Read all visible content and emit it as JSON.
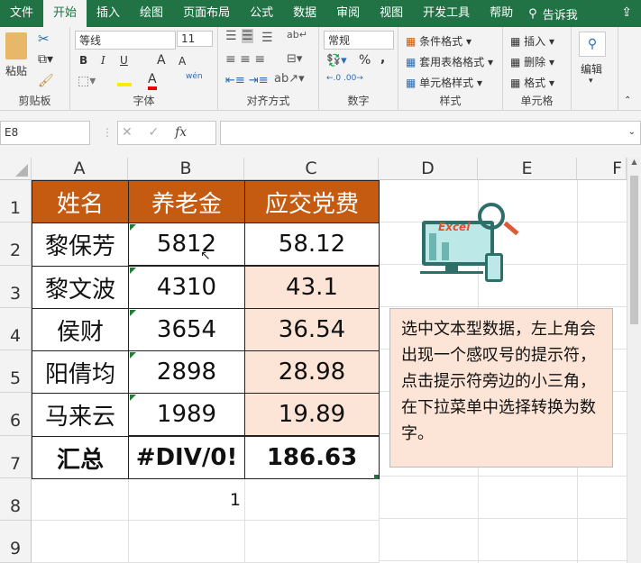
{
  "tabs": [
    "文件",
    "开始",
    "插入",
    "绘图",
    "页面布局",
    "公式",
    "数据",
    "审阅",
    "视图",
    "开发工具",
    "帮助"
  ],
  "tell_me": "告诉我",
  "ribbon": {
    "clipboard": {
      "label": "剪贴板",
      "paste": "粘贴"
    },
    "font": {
      "label": "字体",
      "name": "等线",
      "size": "11",
      "bold": "B",
      "italic": "I",
      "underline": "U",
      "grow": "A",
      "shrink": "A",
      "wen": "wén"
    },
    "alignment": {
      "label": "对齐方式"
    },
    "number": {
      "label": "数字",
      "format": "常规",
      "percent": "%",
      "comma": ","
    },
    "styles": {
      "label": "样式",
      "conditional": "条件格式",
      "table": "套用表格格式",
      "cell": "单元格样式"
    },
    "cells": {
      "label": "单元格",
      "insert": "插入",
      "delete": "删除",
      "format": "格式"
    },
    "editing": {
      "label": "编辑"
    }
  },
  "formula_bar": {
    "name_box": "E8",
    "fx": "fx",
    "value": ""
  },
  "columns": [
    "A",
    "B",
    "C",
    "D",
    "E",
    "F"
  ],
  "rows": [
    "1",
    "2",
    "3",
    "4",
    "5",
    "6",
    "7",
    "8",
    "9"
  ],
  "table": {
    "headers": [
      "姓名",
      "养老金",
      "应交党费"
    ],
    "rows": [
      [
        "黎保芳",
        "5812",
        "58.12"
      ],
      [
        "黎文波",
        "4310",
        "43.1"
      ],
      [
        "侯财",
        "3654",
        "36.54"
      ],
      [
        "阳倩均",
        "2898",
        "28.98"
      ],
      [
        "马来云",
        "1989",
        "19.89"
      ]
    ],
    "total": [
      "汇总",
      "#DIV/0!",
      "186.63"
    ],
    "b8": "1"
  },
  "logo_text": "Excel",
  "note": "选中文本型数据，左上角会出现一个感叹号的提示符，点击提示符旁边的小三角，在下拉菜单中选择转换为数字。",
  "colors": {
    "header": "#c55a11",
    "peach": "#fce4d6",
    "brand": "#217346"
  }
}
